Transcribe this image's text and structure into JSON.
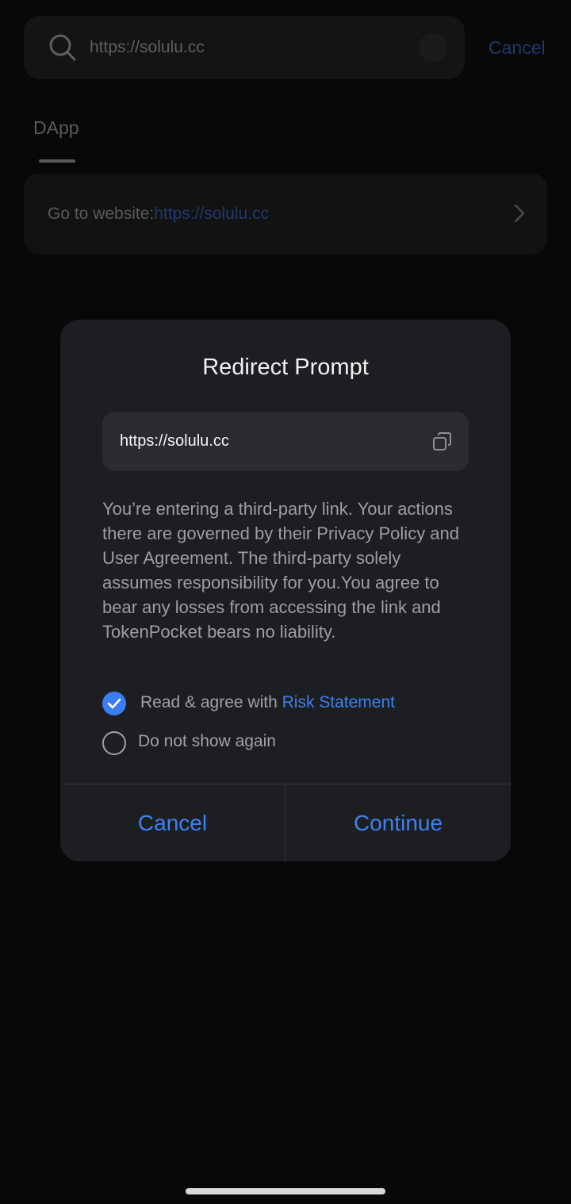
{
  "search": {
    "query": "https://solulu.cc",
    "cancel_label": "Cancel"
  },
  "tabs": [
    {
      "label": "DApp",
      "selected": true
    }
  ],
  "goto": {
    "label": "Go to website:",
    "url": "https://solulu.cc"
  },
  "modal": {
    "title": "Redirect Prompt",
    "url": "https://solulu.cc",
    "description": "You’re entering a third-party link. Your actions there are governed by their Privacy Policy and User Agreement. The third-party solely assumes responsibility for you.You agree to bear any losses from accessing the link and TokenPocket bears no liability.",
    "agree_text": "Read & agree with ",
    "agree_link": "Risk Statement",
    "agree_checked": true,
    "no_show_text": "Do not show again",
    "no_show_checked": false,
    "cancel_label": "Cancel",
    "continue_label": "Continue"
  },
  "icons": {
    "search": "search-icon",
    "clear": "clear-icon",
    "chevron": "chevron-right-icon",
    "copy": "copy-icon",
    "check": "check-icon"
  },
  "colors": {
    "accent": "#3b82f0",
    "modal_bg": "#1d1e21",
    "page_bg": "#080808"
  }
}
